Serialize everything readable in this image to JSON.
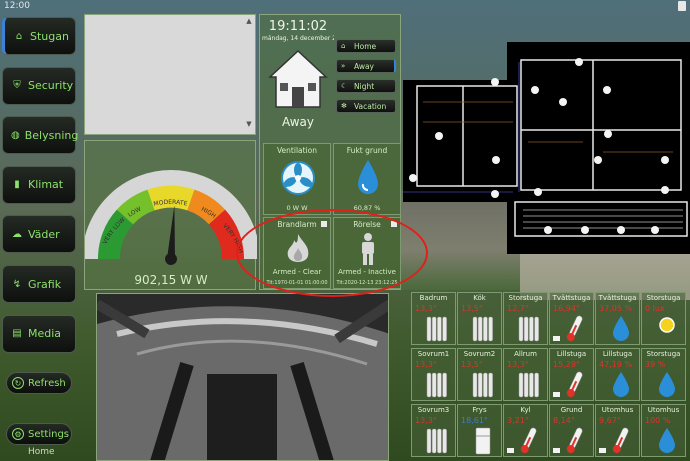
{
  "status_bar": {
    "time": "12:00"
  },
  "sidebar": {
    "items": [
      {
        "label": "Stugan",
        "icon": "home-icon",
        "active": true
      },
      {
        "label": "Security",
        "icon": "shield-icon"
      },
      {
        "label": "Belysning",
        "icon": "bulb-icon"
      },
      {
        "label": "Klimat",
        "icon": "thermometer-icon"
      },
      {
        "label": "Väder",
        "icon": "cloud-icon"
      },
      {
        "label": "Grafik",
        "icon": "chart-icon"
      },
      {
        "label": "Media",
        "icon": "media-icon"
      }
    ],
    "refresh_label": "Refresh",
    "settings_label": "Settings",
    "home_label": "Home"
  },
  "gauge": {
    "labels": [
      "VERY LOW",
      "LOW",
      "MODERATE",
      "HIGH",
      "VERY HIGH"
    ],
    "value": "902,15 W W",
    "level": 0.52
  },
  "clock": {
    "time": "19:11:02",
    "date": "måndag, 14 december 2020",
    "mode_label": "Away"
  },
  "modes": [
    {
      "label": "Home",
      "icon": "home-icon"
    },
    {
      "label": "Away",
      "icon": "fast-forward-icon",
      "active": true
    },
    {
      "label": "Night",
      "icon": "moon-icon"
    },
    {
      "label": "Vacation",
      "icon": "snowflake-icon"
    }
  ],
  "tiles": {
    "ventilation": {
      "title": "Ventilation",
      "value": "0 W W"
    },
    "fukt": {
      "title": "Fukt grund",
      "value": "60,87 %"
    },
    "brandlarm": {
      "title": "Brandlarm",
      "status": "Armed - Clear",
      "time": "Tit:1970-01-01 01:00:00"
    },
    "rorelse": {
      "title": "Rörelse",
      "status": "Armed - Inactive",
      "time": "Tit:2020-12-13 23:12:25"
    }
  },
  "sensors": [
    {
      "name": "Badrum",
      "value": "13,3°",
      "icon": "radiator-icon"
    },
    {
      "name": "Kök",
      "value": "13,5°",
      "icon": "radiator-icon"
    },
    {
      "name": "Storstuga",
      "value": "12,7°",
      "icon": "radiator-icon"
    },
    {
      "name": "Tvättstuga",
      "value": "16,94°",
      "icon": "thermometer-icon",
      "check": true
    },
    {
      "name": "Tvättstuga",
      "value": "37,05 %",
      "icon": "drop-icon"
    },
    {
      "name": "Storstuga",
      "value": "0 lux",
      "icon": "sun-icon"
    },
    {
      "name": "Sovrum1",
      "value": "13,3°",
      "icon": "radiator-icon"
    },
    {
      "name": "Sovrum2",
      "value": "13,5°",
      "icon": "radiator-icon"
    },
    {
      "name": "Allrum",
      "value": "13,3°",
      "icon": "radiator-icon"
    },
    {
      "name": "Lillstuga",
      "value": "15,29°",
      "icon": "thermometer-icon",
      "check": true
    },
    {
      "name": "Lillstuga",
      "value": "47,19 %",
      "icon": "drop-icon"
    },
    {
      "name": "Storstuga",
      "value": "39 %",
      "icon": "drop-icon"
    },
    {
      "name": "Sovrum3",
      "value": "13,3°",
      "icon": "radiator-icon"
    },
    {
      "name": "Frys",
      "value": "18,61°",
      "icon": "freezer-icon",
      "blue": true
    },
    {
      "name": "Kyl",
      "value": "3,21°",
      "icon": "thermometer-icon",
      "check": true
    },
    {
      "name": "Grund",
      "value": "8,14°",
      "icon": "thermometer-icon",
      "check": true
    },
    {
      "name": "Utomhus",
      "value": "9,67°",
      "icon": "thermometer-icon",
      "check": true
    },
    {
      "name": "Utomhus",
      "value": "100 %",
      "icon": "drop-icon"
    }
  ],
  "colors": {
    "accent_green": "#8ee06a",
    "alarm_red": "#e0322a",
    "active_blue": "#3d82d8"
  }
}
